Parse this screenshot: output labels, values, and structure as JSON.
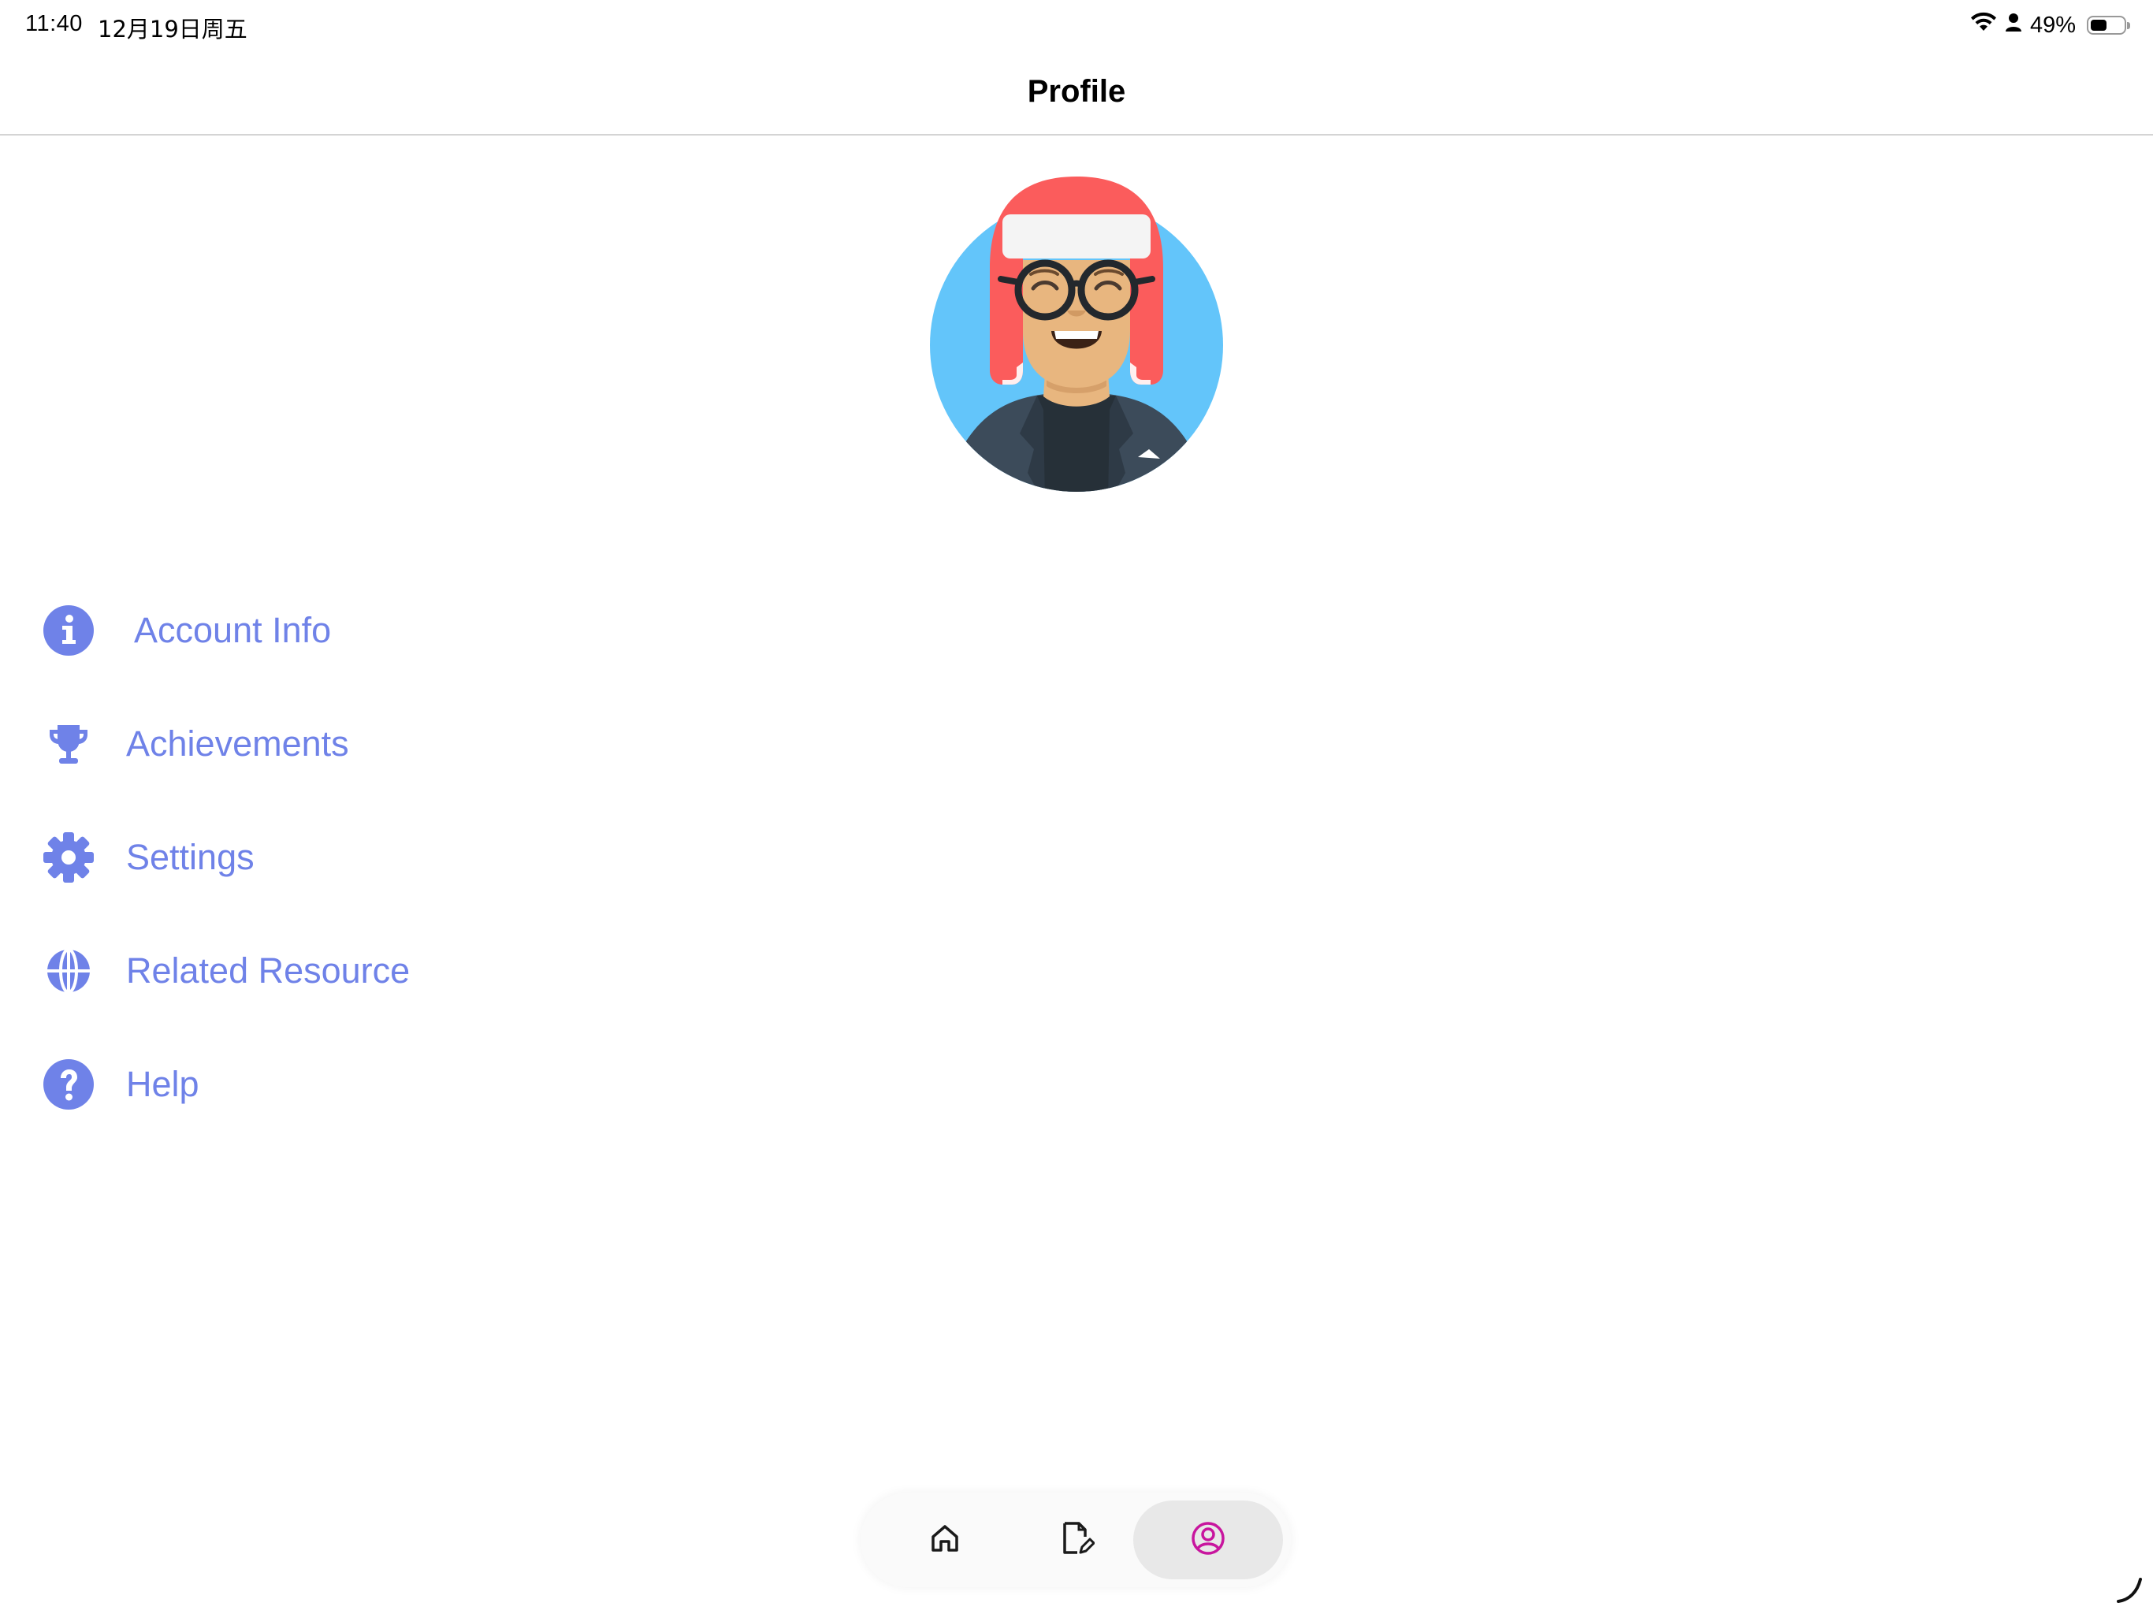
{
  "status_bar": {
    "time": "11:40",
    "date": "12月19日周五",
    "battery_text": "49%",
    "battery_level_percent": 49,
    "icons": [
      "wifi-icon",
      "person-icon",
      "battery-icon"
    ]
  },
  "header": {
    "title": "Profile"
  },
  "avatar": {
    "icon": "avatar-illustration"
  },
  "menu": {
    "items": [
      {
        "label": "Account Info",
        "icon": "info-icon"
      },
      {
        "label": "Achievements",
        "icon": "trophy-icon"
      },
      {
        "label": "Settings",
        "icon": "gear-icon"
      },
      {
        "label": "Related Resource",
        "icon": "globe-icon"
      },
      {
        "label": "Help",
        "icon": "question-icon"
      }
    ]
  },
  "tab_bar": {
    "tabs": [
      {
        "name": "home",
        "icon": "home-icon",
        "active": false
      },
      {
        "name": "document",
        "icon": "document-edit-icon",
        "active": false
      },
      {
        "name": "profile",
        "icon": "profile-icon",
        "active": true
      }
    ]
  },
  "colors": {
    "accent": "#6f82e8",
    "active_tab_icon": "#c8159e",
    "avatar_bg": "#63c5fa",
    "hat": "#fb5c5c",
    "skin": "#e8b67f",
    "jacket": "#3c4b5a"
  }
}
